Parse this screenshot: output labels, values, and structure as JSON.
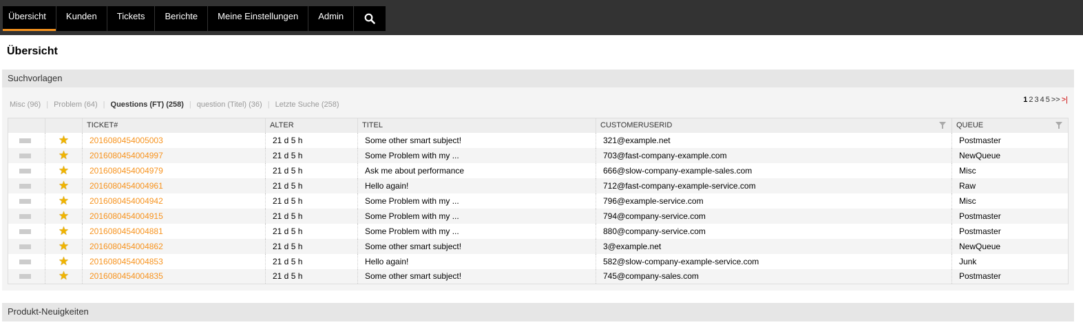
{
  "nav": {
    "items": [
      "Übersicht",
      "Kunden",
      "Tickets",
      "Berichte",
      "Meine Einstellungen",
      "Admin"
    ],
    "active": 0,
    "search_icon": "search-icon"
  },
  "page_title": "Übersicht",
  "section1": {
    "title": "Suchvorlagen",
    "filters": [
      {
        "label": "Misc (96)"
      },
      {
        "label": "Problem (64)"
      },
      {
        "label": "Questions (FT) (258)",
        "active": true
      },
      {
        "label": "question (Titel) (36)"
      },
      {
        "label": "Letzte Suche (258)"
      }
    ],
    "pager": {
      "pages": [
        "1",
        "2",
        "3",
        "4",
        "5"
      ],
      "current": "1",
      "next": ">>",
      "last": ">|"
    },
    "columns": [
      "",
      "",
      "TICKET#",
      "ALTER",
      "TITEL",
      "CUSTOMERUSERID",
      "QUEUE"
    ],
    "rows": [
      {
        "ticket": "2016080454005003",
        "age": "21 d 5 h",
        "title": "Some other smart subject!",
        "customer": "321@example.net",
        "queue": "Postmaster"
      },
      {
        "ticket": "2016080454004997",
        "age": "21 d 5 h",
        "title": "Some Problem with my ...",
        "customer": "703@fast-company-example.com",
        "queue": "NewQueue"
      },
      {
        "ticket": "2016080454004979",
        "age": "21 d 5 h",
        "title": "Ask me about performance",
        "customer": "666@slow-company-example-sales.com",
        "queue": "Misc"
      },
      {
        "ticket": "2016080454004961",
        "age": "21 d 5 h",
        "title": "Hello again!",
        "customer": "712@fast-company-example-service.com",
        "queue": "Raw"
      },
      {
        "ticket": "2016080454004942",
        "age": "21 d 5 h",
        "title": "Some Problem with my ...",
        "customer": "796@example-service.com",
        "queue": "Misc"
      },
      {
        "ticket": "2016080454004915",
        "age": "21 d 5 h",
        "title": "Some Problem with my ...",
        "customer": "794@company-service.com",
        "queue": "Postmaster"
      },
      {
        "ticket": "2016080454004881",
        "age": "21 d 5 h",
        "title": "Some Problem with my ...",
        "customer": "880@company-service.com",
        "queue": "Postmaster"
      },
      {
        "ticket": "2016080454004862",
        "age": "21 d 5 h",
        "title": "Some other smart subject!",
        "customer": "3@example.net",
        "queue": "NewQueue"
      },
      {
        "ticket": "2016080454004853",
        "age": "21 d 5 h",
        "title": "Hello again!",
        "customer": "582@slow-company-example-service.com",
        "queue": "Junk"
      },
      {
        "ticket": "2016080454004835",
        "age": "21 d 5 h",
        "title": "Some other smart subject!",
        "customer": "745@company-sales.com",
        "queue": "Postmaster"
      }
    ]
  },
  "section2": {
    "title": "Produkt-Neuigkeiten"
  },
  "colors": {
    "accent": "#f7931e",
    "star": "#f0b400"
  }
}
